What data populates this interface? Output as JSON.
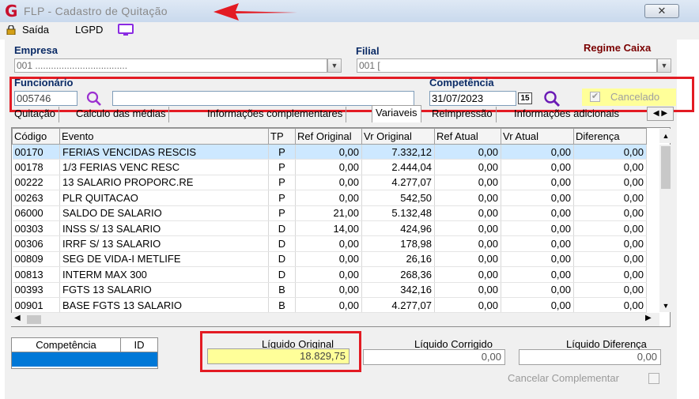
{
  "window": {
    "title": "FLP - Cadastro de Quitação",
    "close_label": "✕"
  },
  "toolbar": {
    "exit_label": "Saída",
    "lgpd_label": "LGPD"
  },
  "empresa": {
    "label": "Empresa",
    "value": "001 ..................................."
  },
  "filial": {
    "label": "Filial",
    "value": "001 ["
  },
  "regime": {
    "label": "Regime Caixa"
  },
  "funcionario": {
    "label": "Funcionário",
    "code": "005746",
    "name": ""
  },
  "competencia": {
    "label": "Competência",
    "value": "31/07/2023",
    "calendar_label": "15"
  },
  "cancelado": {
    "label": "Cancelado",
    "checked": true
  },
  "tabs": [
    {
      "label": "Quitação"
    },
    {
      "label": "Calculo das médias"
    },
    {
      "label": "Informações complementares"
    },
    {
      "label": "Variaveis"
    },
    {
      "label": "Reimpressão"
    },
    {
      "label": "Informações adicionais"
    }
  ],
  "grid": {
    "headers": [
      "Código",
      "Evento",
      "TP",
      "Ref Original",
      "Vr Original",
      "Ref Atual",
      "Vr Atual",
      "Diferença"
    ],
    "rows": [
      [
        "00170",
        "FERIAS VENCIDAS RESCIS",
        "P",
        "0,00",
        "7.332,12",
        "0,00",
        "0,00",
        "0,00"
      ],
      [
        "00178",
        "1/3 FERIAS VENC RESC",
        "P",
        "0,00",
        "2.444,04",
        "0,00",
        "0,00",
        "0,00"
      ],
      [
        "00222",
        "13 SALARIO PROPORC.RE",
        "P",
        "0,00",
        "4.277,07",
        "0,00",
        "0,00",
        "0,00"
      ],
      [
        "00263",
        "PLR QUITACAO",
        "P",
        "0,00",
        "542,50",
        "0,00",
        "0,00",
        "0,00"
      ],
      [
        "06000",
        "SALDO DE SALARIO",
        "P",
        "21,00",
        "5.132,48",
        "0,00",
        "0,00",
        "0,00"
      ],
      [
        "00303",
        "INSS S/ 13 SALARIO",
        "D",
        "14,00",
        "424,96",
        "0,00",
        "0,00",
        "0,00"
      ],
      [
        "00306",
        "IRRF S/ 13 SALARIO",
        "D",
        "0,00",
        "178,98",
        "0,00",
        "0,00",
        "0,00"
      ],
      [
        "00809",
        "SEG DE VIDA-I METLIFE",
        "D",
        "0,00",
        "26,16",
        "0,00",
        "0,00",
        "0,00"
      ],
      [
        "00813",
        "INTERM MAX 300",
        "D",
        "0,00",
        "268,36",
        "0,00",
        "0,00",
        "0,00"
      ],
      [
        "00393",
        "FGTS 13 SALARIO",
        "B",
        "0,00",
        "342,16",
        "0,00",
        "0,00",
        "0,00"
      ],
      [
        "00901",
        "BASE FGTS 13 SALARIO",
        "B",
        "0,00",
        "4.277,07",
        "0,00",
        "0,00",
        "0,00"
      ]
    ]
  },
  "small_grid": {
    "headers": [
      "Competência",
      "ID"
    ]
  },
  "liquido": {
    "original_label": "Líquido Original",
    "original_value": "18.829,75",
    "corrigido_label": "Líquido Corrigido",
    "corrigido_value": "0,00",
    "diferenca_label": "Líquido Diferença",
    "diferenca_value": "0,00"
  },
  "cancelar_complementar": {
    "label": "Cancelar Complementar"
  },
  "colors": {
    "highlight_red": "#e31b23",
    "selected_row": "#cde8ff",
    "selected_blue": "#0078d7",
    "yellow": "#ffff99",
    "label_blue": "#0b2b66",
    "regime_red": "#7a0000"
  }
}
